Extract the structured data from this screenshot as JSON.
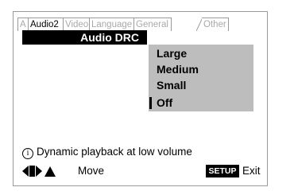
{
  "tabs": [
    {
      "label": "A",
      "active": false
    },
    {
      "label": "Audio2",
      "active": true
    },
    {
      "label": "Video",
      "active": false
    },
    {
      "label": "Language",
      "active": false
    },
    {
      "label": "General",
      "active": false
    },
    {
      "label": "Other",
      "active": false
    }
  ],
  "menu": {
    "setting_label": "Audio DRC",
    "options": [
      "Large",
      "Medium",
      "Small",
      "Off"
    ],
    "selected": "Off"
  },
  "help_text": "Dynamic playback at low volume",
  "footer": {
    "move_label": "Move",
    "setup_label": "SETUP",
    "exit_label": "Exit"
  },
  "colors": {
    "highlight_bar": "#000000",
    "options_panel": "#bdbdbd",
    "inactive_tab_text": "#a9a9a9"
  }
}
